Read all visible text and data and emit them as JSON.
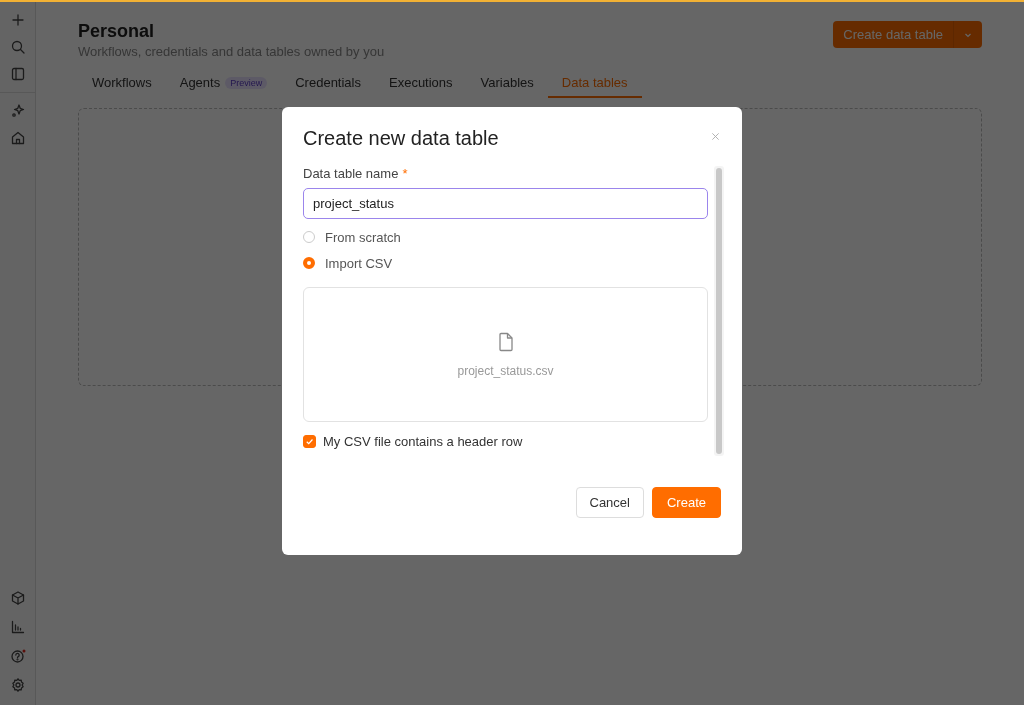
{
  "header": {
    "title": "Personal",
    "subtitle": "Workflows, credentials and data tables owned by you",
    "create_button": "Create data table"
  },
  "tabs": [
    {
      "label": "Workflows",
      "selected": false
    },
    {
      "label": "Agents",
      "badge": "Preview",
      "selected": false
    },
    {
      "label": "Credentials",
      "selected": false
    },
    {
      "label": "Executions",
      "selected": false
    },
    {
      "label": "Variables",
      "selected": false
    },
    {
      "label": "Data tables",
      "selected": true
    }
  ],
  "dialog": {
    "title": "Create new data table",
    "name_field": {
      "label": "Data table name",
      "required_mark": "*",
      "value": "project_status"
    },
    "options": [
      {
        "label": "From scratch",
        "selected": false
      },
      {
        "label": "Import CSV",
        "selected": true
      }
    ],
    "upload": {
      "file_name": "project_status.csv"
    },
    "header_row": {
      "label": "My CSV file contains a header row",
      "checked": true
    },
    "buttons": [
      {
        "label": "Cancel",
        "kind": "secondary"
      },
      {
        "label": "Create",
        "kind": "primary"
      }
    ]
  }
}
